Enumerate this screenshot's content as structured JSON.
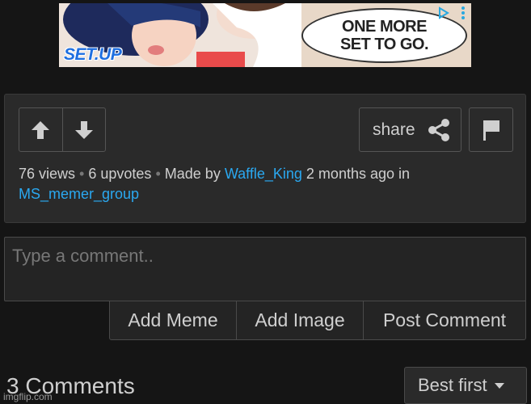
{
  "ad": {
    "brand": "SET.UP",
    "bubble_text": "ONE MORE SET TO GO.",
    "choice_icon": "adchoices-icon",
    "menu_icon": "more-vertical-icon"
  },
  "post": {
    "share_label": "share",
    "views": "76 views",
    "separator": "•",
    "upvotes": "6 upvotes",
    "made_by": "Made by",
    "author": "Waffle_King",
    "time": "2 months ago in",
    "stream": "MS_memer_group"
  },
  "comment": {
    "placeholder": "Type a comment..",
    "add_meme": "Add Meme",
    "add_image": "Add Image",
    "post_comment": "Post Comment"
  },
  "comments": {
    "count_label": "3 Comments",
    "sort_label": "Best first"
  },
  "watermark": "imgflip.com",
  "colors": {
    "background": "#151515",
    "panel": "#2a2a2a",
    "link": "#2aa8f0",
    "text": "#cfcfcf"
  }
}
